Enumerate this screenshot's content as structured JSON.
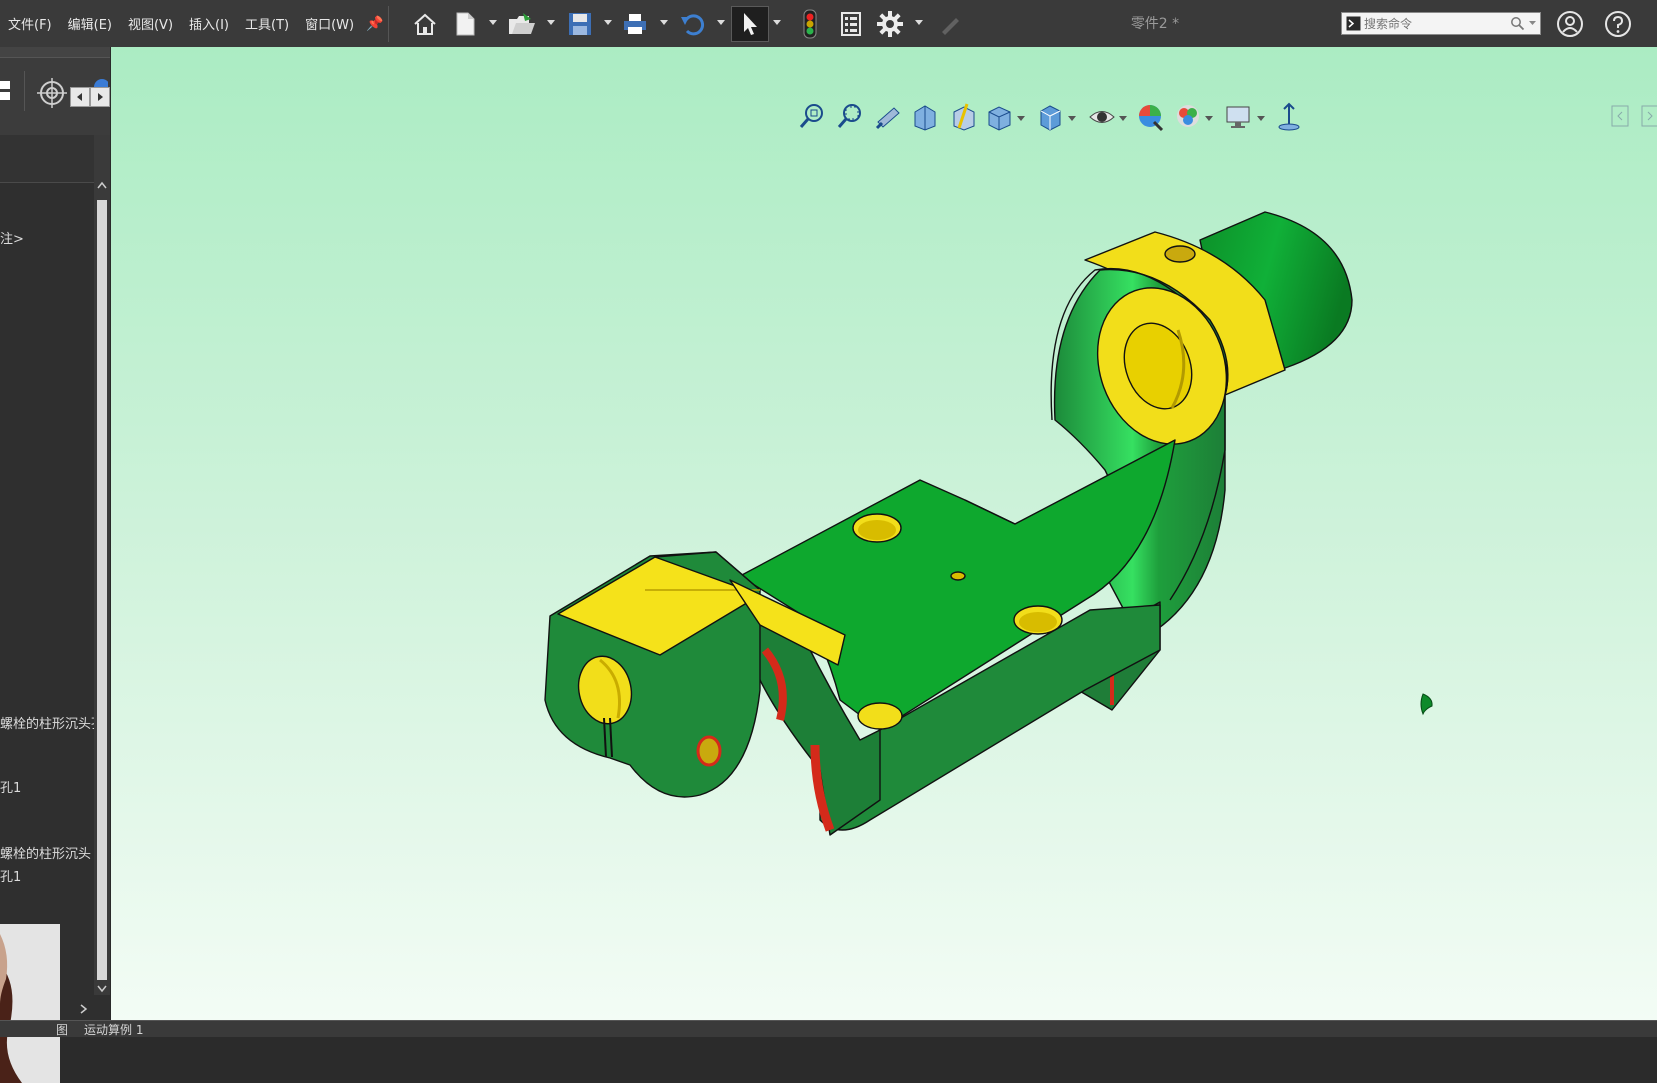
{
  "menu": {
    "items": [
      "文件(F)",
      "编辑(E)",
      "视图(V)",
      "插入(I)",
      "工具(T)",
      "窗口(W)"
    ]
  },
  "toolbar": {
    "icons": [
      "home-icon",
      "new-document-icon",
      "open-folder-icon",
      "save-icon",
      "print-icon",
      "undo-icon",
      "select-arrow-icon",
      "rebuild-traffic-light-icon",
      "file-properties-icon",
      "options-gear-icon"
    ]
  },
  "document": {
    "title": "零件2 *"
  },
  "search": {
    "placeholder": "搜索命令"
  },
  "feature_tree": {
    "items": [
      {
        "label": "注>"
      },
      {
        "label": "螺栓的柱形沉头孔"
      },
      {
        "label": "孔1"
      },
      {
        "label": "螺栓的柱形沉头"
      },
      {
        "label": "孔1"
      }
    ]
  },
  "bottom_tabs": [
    "图",
    "运动算例 1"
  ],
  "heads_up_toolbar": {
    "icons": [
      "zoom-to-fit-icon",
      "zoom-to-area-icon",
      "previous-view-icon",
      "section-view-icon",
      "dynamic-annotation-icon",
      "view-orientation-icon",
      "display-style-icon",
      "hide-show-icon",
      "edit-appearance-icon",
      "apply-scene-icon",
      "view-settings-icon",
      "rotate-pin-icon"
    ]
  },
  "colors": {
    "part_green": "#24a83c",
    "face_yellow": "#f5e21a",
    "fillet_red": "#d42a1a",
    "viewport_top": "#abecc3",
    "viewport_bottom": "#f3fcf5"
  }
}
